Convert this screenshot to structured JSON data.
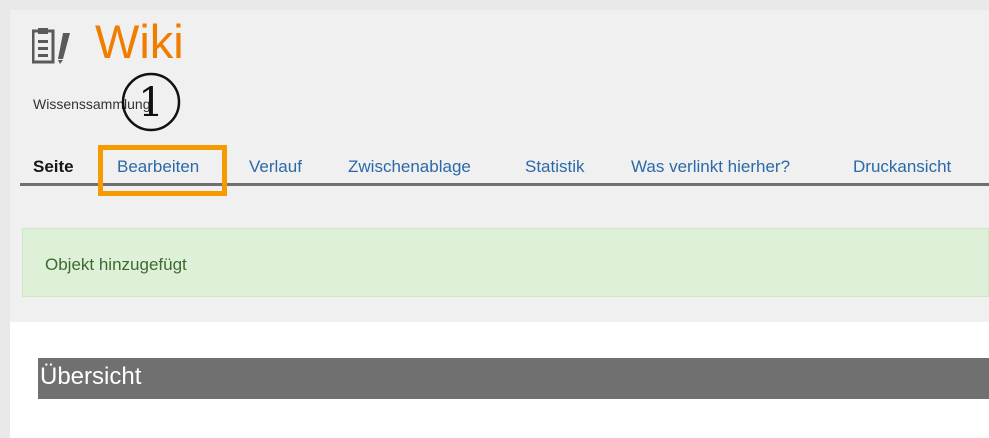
{
  "header": {
    "title": "Wiki",
    "subtitle": "Wissenssammlung",
    "icon": "wiki-document-icon",
    "accent_color": "#f07d00"
  },
  "annotation": {
    "step_number": "1",
    "highlight_color": "#f59b00"
  },
  "tabs": [
    {
      "label": "Seite",
      "active": true
    },
    {
      "label": "Bearbeiten",
      "active": false
    },
    {
      "label": "Verlauf",
      "active": false
    },
    {
      "label": "Zwischenablage",
      "active": false
    },
    {
      "label": "Statistik",
      "active": false
    },
    {
      "label": "Was verlinkt hierher?",
      "active": false
    },
    {
      "label": "Druckansicht",
      "active": false
    }
  ],
  "message": {
    "text": "Objekt hinzugefügt",
    "type": "success"
  },
  "section": {
    "title": "Übersicht"
  }
}
